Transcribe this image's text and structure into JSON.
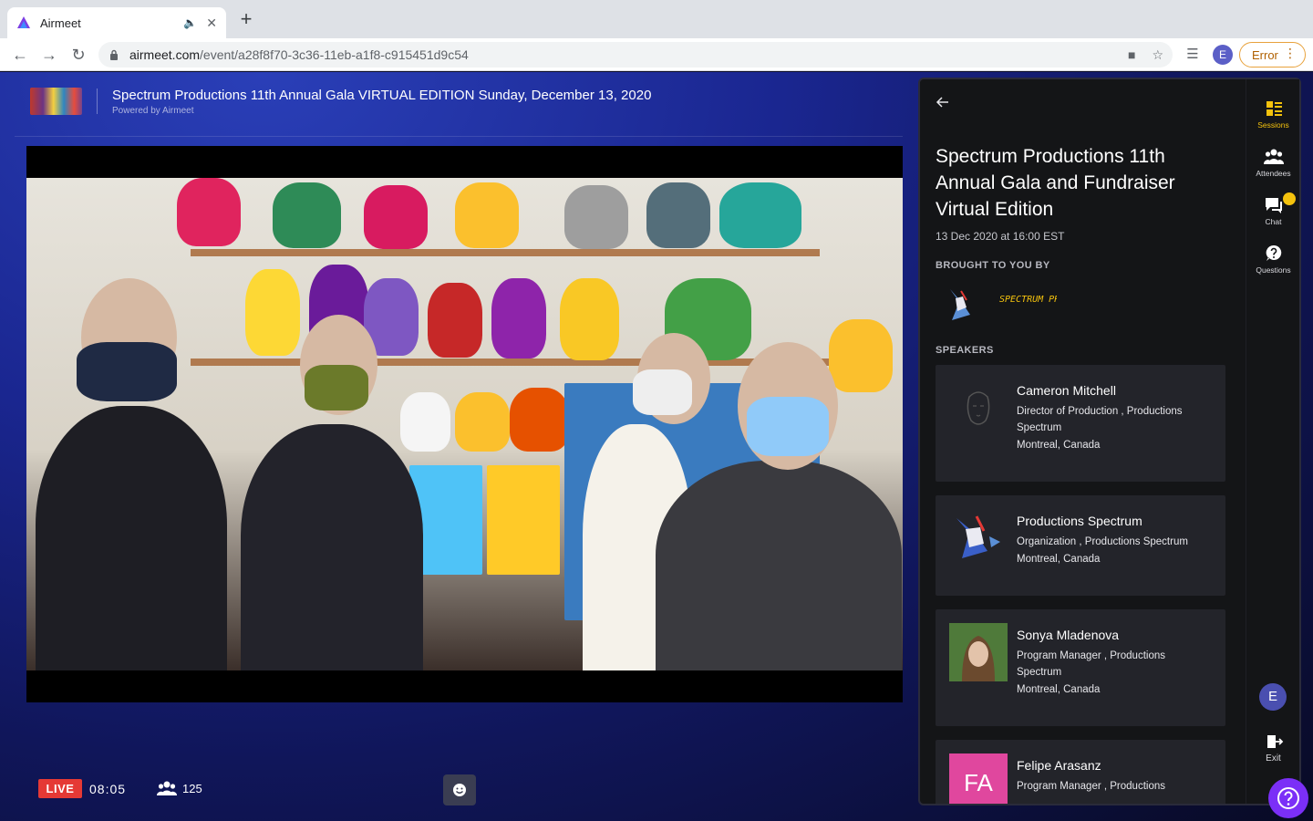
{
  "browser": {
    "tab_title": "Airmeet",
    "new_tab_label": "+",
    "url_domain": "airmeet.com",
    "url_path": "/event/a28f8f70-3c36-11eb-a1f8-c915451d9c54",
    "profile_initial": "E",
    "error_label": "Error"
  },
  "event": {
    "title": "Spectrum Productions 11th Annual Gala VIRTUAL EDITION Sunday, December 13, 2020",
    "powered_by": "Powered by Airmeet"
  },
  "stream": {
    "live_label": "LIVE",
    "elapsed": "08:05",
    "viewer_count": "125"
  },
  "session": {
    "title": "Spectrum Productions 11th Annual Gala and Fundraiser Virtual Edition",
    "date": "13 Dec 2020 at 16:00 EST",
    "brought_label": "BROUGHT TO YOU BY",
    "sponsor_logo_text": "SPECTRUM PRODUCTIONS",
    "speakers_label": "SPEAKERS",
    "speakers": [
      {
        "name": "Cameron Mitchell",
        "role": "Director of Production , Productions Spectrum",
        "location": "Montreal, Canada"
      },
      {
        "name": "Productions Spectrum",
        "role": "Organization , Productions Spectrum",
        "location": "Montreal, Canada"
      },
      {
        "name": "Sonya Mladenova",
        "role": "Program Manager , Productions Spectrum",
        "location": "Montreal, Canada"
      },
      {
        "name": "Felipe Arasanz",
        "role": "Program Manager , Productions",
        "initials": "FA"
      }
    ]
  },
  "rail": {
    "sessions": "Sessions",
    "attendees": "Attendees",
    "chat": "Chat",
    "questions": "Questions",
    "user_initial": "E",
    "exit": "Exit"
  },
  "colors": {
    "accent_yellow": "#f4c20d",
    "live_red": "#e53935",
    "help_purple": "#7b2ff7"
  }
}
